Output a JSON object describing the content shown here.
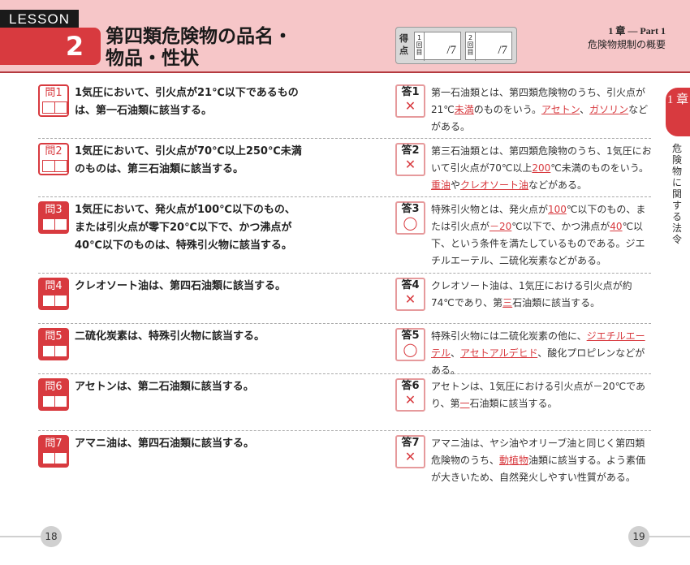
{
  "header": {
    "lesson_tag": "LESSON",
    "lesson_number": "2",
    "title_line1": "第四類危険物の品名・",
    "title_line2": "物品・性状",
    "score_label": "得点",
    "score1_label": "1回目",
    "score2_label": "2回目",
    "score_total1": "/7",
    "score_total2": "/7",
    "chapter_line1": "1 章 — Part 1",
    "chapter_line2": "危険物規制の概要"
  },
  "side": {
    "chapter_no": "1 章",
    "chapter_title": "危険物に関する法令"
  },
  "items": [
    {
      "q_label": "問1",
      "q_text": "1気圧において、引火点が21℃以下であるものは、第一石油類に該当する。",
      "a_label": "答1",
      "a_mark": "✕",
      "a_parts": [
        "第一石油類とは、第四類危険物のうち、引火点が21℃",
        "未満",
        "のものをいう。",
        "アセトン",
        "、",
        "ガソリン",
        "などがある。"
      ]
    },
    {
      "q_label": "問2",
      "q_text": "1気圧において、引火点が70℃以上250℃未満のものは、第三石油類に該当する。",
      "a_label": "答2",
      "a_mark": "✕",
      "a_parts": [
        "第三石油類とは、第四類危険物のうち、1気圧において引火点が70℃以上",
        "200",
        "℃未満のものをいう。",
        "重油",
        "や",
        "クレオソート油",
        "などがある。"
      ]
    },
    {
      "q_label": "問3",
      "q_text": "1気圧において、発火点が100℃以下のもの、または引火点が零下20℃以下で、かつ沸点が40℃以下のものは、特殊引火物に該当する。",
      "a_label": "答3",
      "a_mark": "◯",
      "a_parts": [
        "特殊引火物とは、発火点が",
        "100",
        "℃以下のもの、または引火点が",
        "－20",
        "℃以下で、かつ沸点が",
        "40",
        "℃以下、という条件を満たしているものである。ジエチルエーテル、二硫化炭素などがある。"
      ]
    },
    {
      "q_label": "問4",
      "q_text": "クレオソート油は、第四石油類に該当する。",
      "a_label": "答4",
      "a_mark": "✕",
      "a_parts": [
        "クレオソート油は、1気圧における引火点が約74℃であり、第",
        "三",
        "石油類に該当する。"
      ]
    },
    {
      "q_label": "問5",
      "q_text": "二硫化炭素は、特殊引火物に該当する。",
      "a_label": "答5",
      "a_mark": "◯",
      "a_parts": [
        "特殊引火物には二硫化炭素の他に、",
        "ジエチルエーテル",
        "、",
        "アセトアルデヒド",
        "、酸化プロピレンなどがある。"
      ]
    },
    {
      "q_label": "問6",
      "q_text": "アセトンは、第二石油類に該当する。",
      "a_label": "答6",
      "a_mark": "✕",
      "a_parts": [
        "アセトンは、1気圧における引火点が－20℃であり、第",
        "一",
        "石油類に該当する。"
      ]
    },
    {
      "q_label": "問7",
      "q_text": "アマニ油は、第四石油類に該当する。",
      "a_label": "答7",
      "a_mark": "✕",
      "a_parts": [
        "アマニ油は、ヤシ油やオリーブ油と同じく第四類危険物のうち、",
        "動植物",
        "油類に該当する。よう素価が大きいため、自然発火しやすい性質がある。"
      ]
    }
  ],
  "footer": {
    "page_left": "18",
    "page_right": "19"
  }
}
